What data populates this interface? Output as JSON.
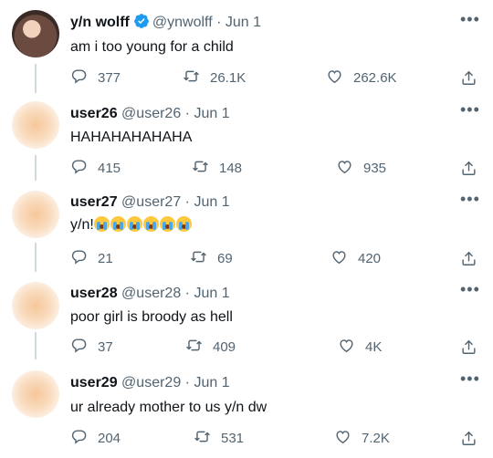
{
  "tweets": [
    {
      "name": "y/n wolff",
      "verified": true,
      "handle": "@ynwolff",
      "separator": "·",
      "date": "Jun 1",
      "text": "am i too young for a child",
      "replies": "377",
      "retweets": "26.1K",
      "likes": "262.6K"
    },
    {
      "name": "user26",
      "handle": "@user26",
      "separator": "·",
      "date": "Jun 1",
      "text": "HAHAHAHAHAHA",
      "replies": "415",
      "retweets": "148",
      "likes": "935"
    },
    {
      "name": "user27",
      "handle": "@user27",
      "separator": "·",
      "date": "Jun 1",
      "text": "y/n!",
      "emoji_count": 6,
      "emoji_name": "loudly-crying-face",
      "replies": "21",
      "retweets": "69",
      "likes": "420"
    },
    {
      "name": "user28",
      "handle": "@user28",
      "separator": "·",
      "date": "Jun 1",
      "text": "poor girl is broody as hell",
      "replies": "37",
      "retweets": "409",
      "likes": "4K"
    },
    {
      "name": "user29",
      "handle": "@user29",
      "separator": "·",
      "date": "Jun 1",
      "text": "ur already mother to us y/n dw",
      "replies": "204",
      "retweets": "531",
      "likes": "7.2K"
    }
  ],
  "icons": {
    "reply": "reply-icon",
    "retweet": "retweet-icon",
    "like": "like-icon",
    "share": "share-icon",
    "more": "more-icon",
    "verified": "verified-badge-icon"
  },
  "colors": {
    "verified_blue": "#1d9bf0",
    "muted_text": "#536471",
    "thread_line": "#cfd9de"
  }
}
